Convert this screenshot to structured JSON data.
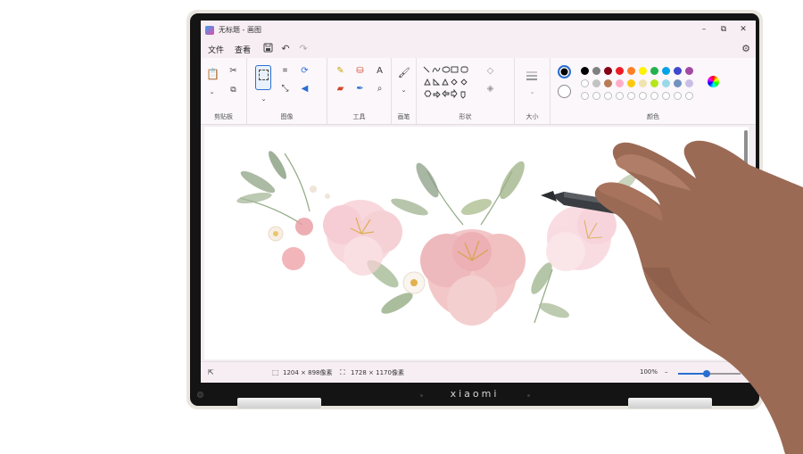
{
  "window": {
    "title": "无标题 - 画图",
    "minimize_icon": "minimize-icon",
    "maximize_icon": "maximize-icon",
    "close_icon": "close-icon"
  },
  "menubar": {
    "file": "文件",
    "view": "查看",
    "save_icon": "save-icon",
    "undo_icon": "undo-icon",
    "redo_icon": "redo-icon",
    "settings_icon": "settings-icon"
  },
  "ribbon": {
    "groups": {
      "clipboard": "剪贴板",
      "image": "图像",
      "tools": "工具",
      "brushes": "画笔",
      "shapes": "形状",
      "size": "大小",
      "colors": "颜色"
    },
    "tools_text_glyph": "A"
  },
  "colors": {
    "primary": "#000000",
    "secondary": "#ffffff",
    "palette_row1": [
      "#000000",
      "#7f7f7f",
      "#880015",
      "#ed1c24",
      "#ff7f27",
      "#fff200",
      "#22b14c",
      "#00a2e8",
      "#3f48cc",
      "#a349a4"
    ],
    "palette_row2": [
      "#ffffff",
      "#c3c3c3",
      "#b97a57",
      "#ffaec9",
      "#ffc90e",
      "#efe4b0",
      "#b5e61d",
      "#99d9ea",
      "#7092be",
      "#c8bfe7"
    ],
    "accent": "#2a6fd2"
  },
  "status": {
    "selection_size": "1204 × 898像素",
    "canvas_size": "1728 × 1170像素",
    "zoom": "100%",
    "zoom_level": 0.45
  },
  "device": {
    "brand": "xiaomi"
  }
}
